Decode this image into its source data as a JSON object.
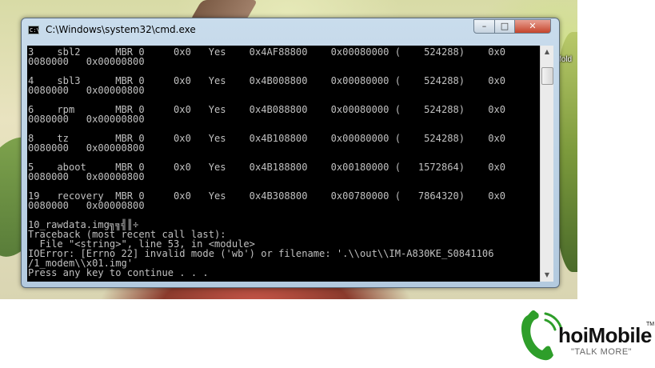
{
  "window": {
    "title": "C:\\Windows\\system32\\cmd.exe",
    "icon_label": "C:\\",
    "controls": {
      "minimize": "–",
      "maximize": "□",
      "close": "✕"
    }
  },
  "console": {
    "lines": [
      "3    sbl2      MBR 0     0x0   Yes    0x4AF88800    0x00080000 (    524288)    0x0",
      "0080000   0x00000800",
      "",
      "4    sbl3      MBR 0     0x0   Yes    0x4B008800    0x00080000 (    524288)    0x0",
      "0080000   0x00000800",
      "",
      "6    rpm       MBR 0     0x0   Yes    0x4B088800    0x00080000 (    524288)    0x0",
      "0080000   0x00000800",
      "",
      "8    tz        MBR 0     0x0   Yes    0x4B108800    0x00080000 (    524288)    0x0",
      "0080000   0x00000800",
      "",
      "5    aboot     MBR 0     0x0   Yes    0x4B188800    0x00180000 (   1572864)    0x0",
      "0080000   0x00000800",
      "",
      "19   recovery  MBR 0     0x0   Yes    0x4B308800    0x00780000 (   7864320)    0x0",
      "0080000   0x00000800",
      "",
      "10_rawdata.img╗╗╣║÷",
      "Traceback (most recent call last):",
      "  File \"<string>\", line 53, in <module>",
      "IOError: [Errno 22] invalid mode ('wb') or filename: '.\\\\out\\\\IM-A830KE_S0841106",
      "/1_modem\\\\x01.img'",
      "Press any key to continue . . ."
    ]
  },
  "scrollbar": {
    "up": "▲",
    "down": "▼"
  },
  "desktop": {
    "label": "fold"
  },
  "logo": {
    "name": "hoiMobile",
    "tm": "TM",
    "tagline": "\"TALK MORE\"",
    "phone_color": "#2e9e2a",
    "icon": "phone-handset-icon"
  },
  "colors": {
    "console_bg": "#000000",
    "console_fg": "#c0c0c0",
    "close_button": "#c5442b",
    "logo_green": "#2e9e2a"
  }
}
